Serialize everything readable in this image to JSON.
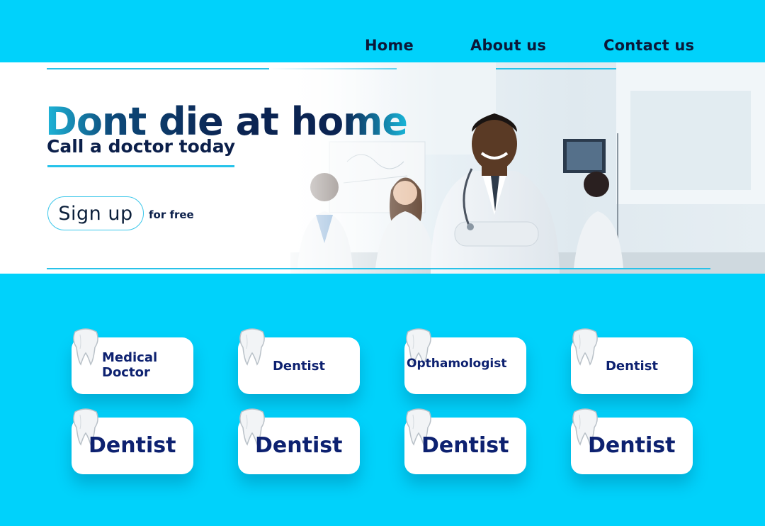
{
  "nav": {
    "items": [
      "Home",
      "About us",
      "Contact us"
    ]
  },
  "hero": {
    "headline": "Dont die at home",
    "subheadline": "Call a doctor today",
    "signup_label": "Sign up",
    "signup_note": "for free"
  },
  "specialties": {
    "row1": [
      "Medical Doctor",
      "Dentist",
      "Opthamologist",
      "Dentist"
    ],
    "row2": [
      "Dentist",
      "Dentist",
      "Dentist",
      "Dentist"
    ]
  },
  "colors": {
    "background": "#00d2fb",
    "nav_text": "#0b1838",
    "headline": "#0b2452",
    "accent_rule": "#27c2e9",
    "card_text": "#0d2170"
  },
  "icons": {
    "card_icon": "tooth-icon",
    "hero_image": "doctors-photo"
  }
}
